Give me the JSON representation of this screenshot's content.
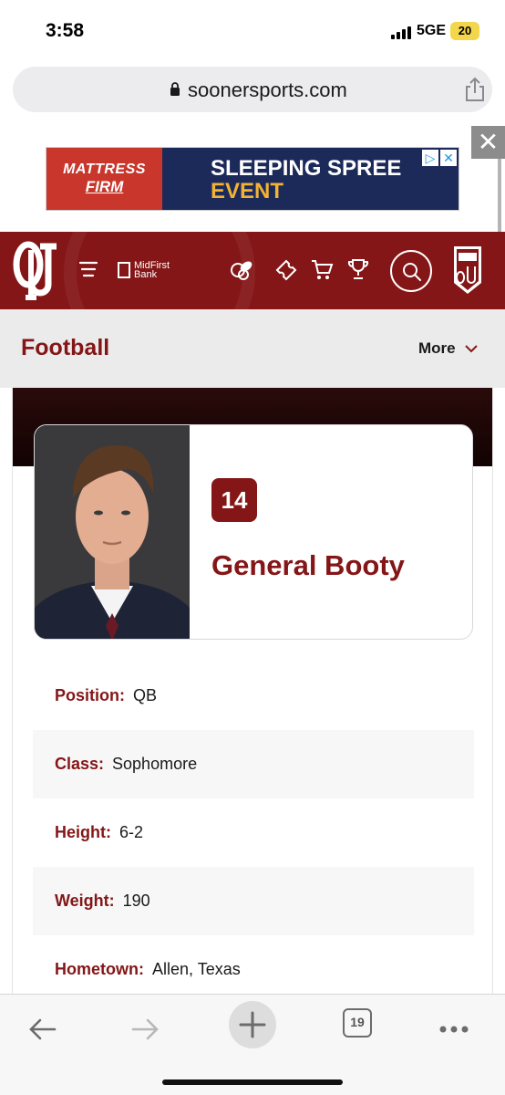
{
  "status": {
    "time": "3:58",
    "network": "5GE",
    "battery": "20"
  },
  "browser": {
    "url": "soonersports.com",
    "tabs_count": "19"
  },
  "ad": {
    "brand_line1": "MATTRESS",
    "brand_line2": "FIRM",
    "headline1": "SLEEPING SPREE",
    "headline2": "EVENT",
    "close": "✕"
  },
  "header": {
    "bank_line1": "MidFirst",
    "bank_line2": "Bank"
  },
  "subnav": {
    "title": "Football",
    "more_label": "More"
  },
  "player": {
    "number": "14",
    "name": "General Booty",
    "bio": [
      {
        "label": "Position:",
        "value": "QB"
      },
      {
        "label": "Class:",
        "value": "Sophomore"
      },
      {
        "label": "Height:",
        "value": "6-2"
      },
      {
        "label": "Weight:",
        "value": "190"
      },
      {
        "label": "Hometown:",
        "value": "Allen, Texas"
      }
    ]
  },
  "colors": {
    "brand_crimson": "#841617",
    "ad_navy": "#1c2a5a",
    "ad_red": "#c8362c",
    "ad_gold": "#f2b233"
  }
}
